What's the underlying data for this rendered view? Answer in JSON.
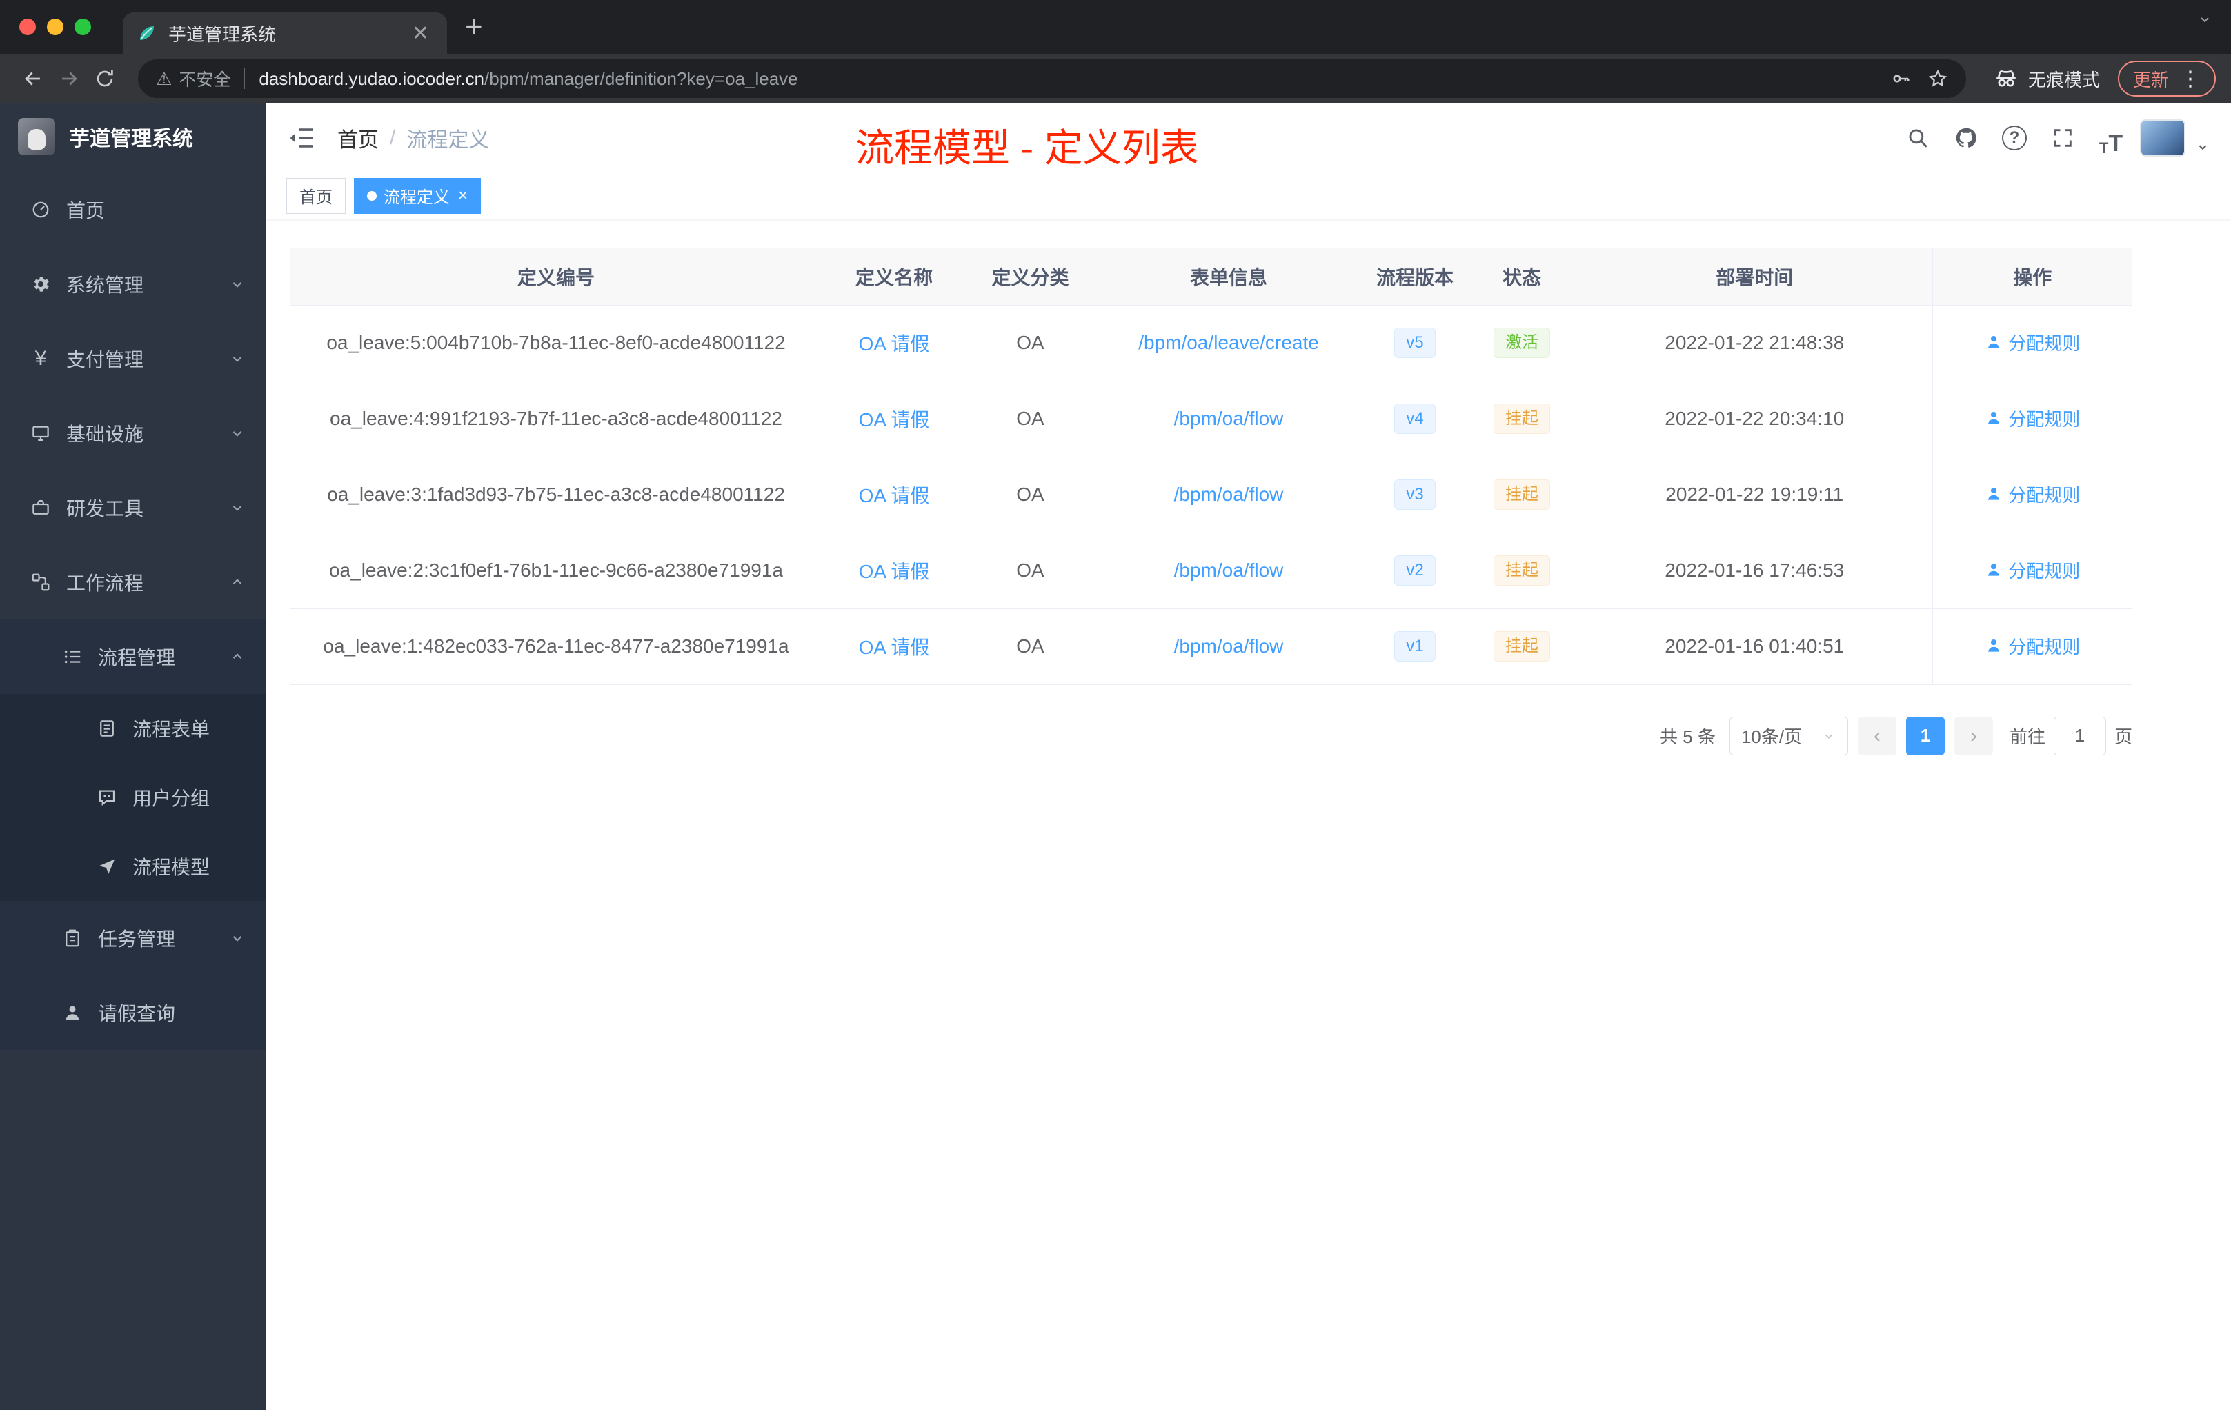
{
  "browser": {
    "tab_title": "芋道管理系统",
    "security_label": "不安全",
    "url_domain": "dashboard.yudao.iocoder.cn",
    "url_path": "/bpm/manager/definition?key=oa_leave",
    "incognito_label": "无痕模式",
    "update_label": "更新"
  },
  "sidebar": {
    "logo_title": "芋道管理系统",
    "items": [
      {
        "label": "首页"
      },
      {
        "label": "系统管理"
      },
      {
        "label": "支付管理"
      },
      {
        "label": "基础设施"
      },
      {
        "label": "研发工具"
      },
      {
        "label": "工作流程"
      },
      {
        "label": "流程管理"
      },
      {
        "label": "流程表单"
      },
      {
        "label": "用户分组"
      },
      {
        "label": "流程模型"
      },
      {
        "label": "任务管理"
      },
      {
        "label": "请假查询"
      }
    ]
  },
  "header": {
    "breadcrumb_home": "首页",
    "breadcrumb_sep": "/",
    "breadcrumb_current": "流程定义",
    "annotation": "流程模型 - 定义列表"
  },
  "tags": {
    "home": "首页",
    "active": "流程定义"
  },
  "table": {
    "columns": [
      "定义编号",
      "定义名称",
      "定义分类",
      "表单信息",
      "流程版本",
      "状态",
      "部署时间",
      "操作"
    ],
    "rows": [
      {
        "id": "oa_leave:5:004b710b-7b8a-11ec-8ef0-acde48001122",
        "name": "OA 请假",
        "category": "OA",
        "form": "/bpm/oa/leave/create",
        "version": "v5",
        "status": "激活",
        "status_type": "success",
        "time": "2022-01-22 21:48:38",
        "action": "分配规则"
      },
      {
        "id": "oa_leave:4:991f2193-7b7f-11ec-a3c8-acde48001122",
        "name": "OA 请假",
        "category": "OA",
        "form": "/bpm/oa/flow",
        "version": "v4",
        "status": "挂起",
        "status_type": "warning",
        "time": "2022-01-22 20:34:10",
        "action": "分配规则"
      },
      {
        "id": "oa_leave:3:1fad3d93-7b75-11ec-a3c8-acde48001122",
        "name": "OA 请假",
        "category": "OA",
        "form": "/bpm/oa/flow",
        "version": "v3",
        "status": "挂起",
        "status_type": "warning",
        "time": "2022-01-22 19:19:11",
        "action": "分配规则"
      },
      {
        "id": "oa_leave:2:3c1f0ef1-76b1-11ec-9c66-a2380e71991a",
        "name": "OA 请假",
        "category": "OA",
        "form": "/bpm/oa/flow",
        "version": "v2",
        "status": "挂起",
        "status_type": "warning",
        "time": "2022-01-16 17:46:53",
        "action": "分配规则"
      },
      {
        "id": "oa_leave:1:482ec033-762a-11ec-8477-a2380e71991a",
        "name": "OA 请假",
        "category": "OA",
        "form": "/bpm/oa/flow",
        "version": "v1",
        "status": "挂起",
        "status_type": "warning",
        "time": "2022-01-16 01:40:51",
        "action": "分配规则"
      }
    ]
  },
  "pagination": {
    "total": "共 5 条",
    "page_size": "10条/页",
    "current_page": "1",
    "goto_label": "前往",
    "goto_value": "1",
    "page_label": "页"
  },
  "colors": {
    "accent": "#409eff",
    "annotation": "#ff2600",
    "success": "#67c23a",
    "warning": "#e6a23c",
    "sidebar_bg": "#2d3442"
  }
}
